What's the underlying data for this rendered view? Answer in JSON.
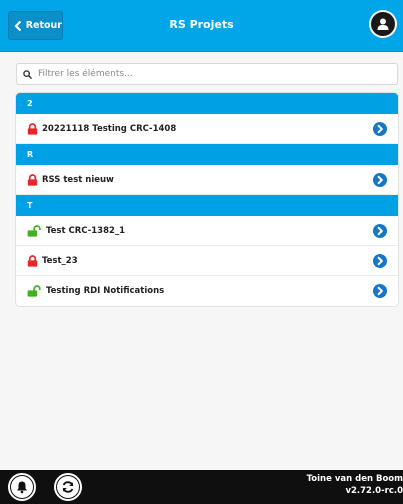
{
  "header": {
    "back_label": "Retour",
    "title": "RS Projets"
  },
  "search": {
    "placeholder": "Filtrer les éléments..."
  },
  "list": {
    "groups": [
      {
        "letter": "2",
        "items": [
          {
            "label": "20221118 Testing CRC-1408",
            "lock": "locked"
          }
        ]
      },
      {
        "letter": "R",
        "items": [
          {
            "label": "RSS test nieuw",
            "lock": "locked"
          }
        ]
      },
      {
        "letter": "T",
        "items": [
          {
            "label": "Test CRC-1382_1",
            "lock": "unlocked"
          },
          {
            "label": "Test_23",
            "lock": "locked"
          },
          {
            "label": "Testing RDI Notifications",
            "lock": "unlocked"
          }
        ]
      }
    ]
  },
  "footer": {
    "user": "Toine van den Boom",
    "version": "v2.72.0-rc.0"
  },
  "colors": {
    "accent": "#00a6e8",
    "locked": "#e6262d",
    "unlocked": "#3fb21d",
    "go": "#1677c8"
  },
  "icons": {
    "back": "chevron-left-icon",
    "user": "user-icon",
    "search": "search-icon",
    "locked": "lock-icon",
    "unlocked": "unlock-icon",
    "go": "chevron-circle-right-icon",
    "notifications": "bell-icon",
    "refresh": "refresh-icon"
  }
}
